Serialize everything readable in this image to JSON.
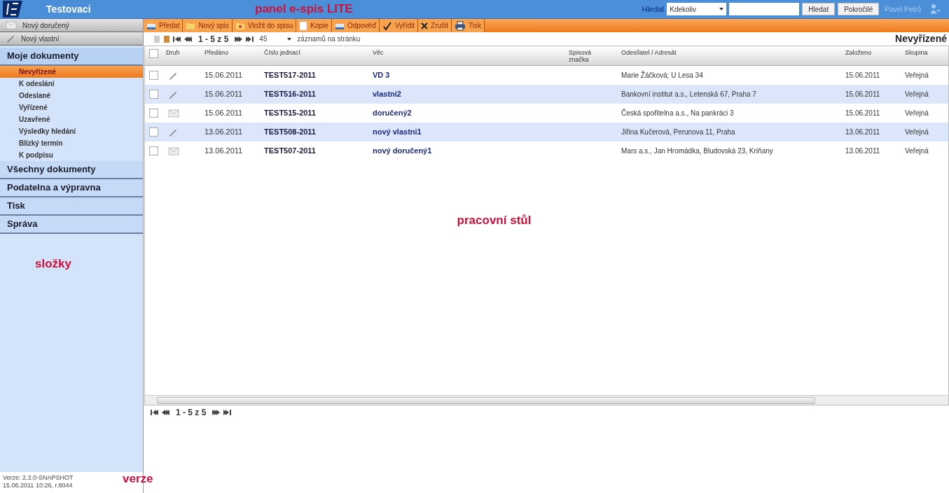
{
  "header": {
    "app_name": "Testovaci",
    "annotation": "panel e-spis LITE",
    "search_label": "Hledat",
    "scope": "Kdekoliv",
    "buttons": [
      "Hledat",
      "Pokročilé"
    ],
    "user": "Pavel Petrů"
  },
  "new_buttons": [
    {
      "label": "Nový doručený",
      "kind": "received"
    },
    {
      "label": "Nový vlastní",
      "kind": "own"
    }
  ],
  "toolbar": [
    {
      "label": "Předat",
      "kind": "tray"
    },
    {
      "label": "Nový spis",
      "kind": "folder"
    },
    {
      "label": "Vložit do spisu",
      "kind": "insert"
    },
    {
      "label": "Kopie",
      "kind": "page"
    },
    {
      "label": "Odpověď",
      "kind": "tray"
    },
    {
      "label": "Vyřídit",
      "kind": "check"
    },
    {
      "label": "Zrušit",
      "kind": "cross"
    },
    {
      "label": "Tisk",
      "kind": "print"
    }
  ],
  "pager": {
    "range": "1 - 5 z 5",
    "per_page": "45",
    "per_page_label": "záznamů na stránku"
  },
  "view_title": "Nevyřízené",
  "sidebar": [
    {
      "label": "Moje dokumenty",
      "expanded": true,
      "children": [
        {
          "label": "Nevyřízené",
          "selected": true
        },
        {
          "label": "K odeslání",
          "selected": false
        },
        {
          "label": "Odeslané",
          "selected": false
        },
        {
          "label": "Vyřízené",
          "selected": false
        },
        {
          "label": "Uzavřené",
          "selected": false
        },
        {
          "label": "Výsledky hledání",
          "selected": false
        },
        {
          "label": "Blízký termín",
          "selected": false
        },
        {
          "label": "K podpisu",
          "selected": false
        }
      ]
    },
    {
      "label": "Všechny dokumenty",
      "expanded": false
    },
    {
      "label": "Podatelna a výpravna",
      "expanded": false
    },
    {
      "label": "Tisk",
      "expanded": false
    },
    {
      "label": "Správa",
      "expanded": false
    }
  ],
  "table": {
    "all_checked": false,
    "columns": [
      "Druh",
      "Předáno",
      "Číslo jednací",
      "Věc",
      "Spisová značka",
      "Odesílatel / Adresát",
      "Založeno",
      "Skupina"
    ],
    "rows": [
      {
        "checked": false,
        "kind": "own",
        "handed": "15.06.2011",
        "number": "TEST517-2011",
        "subject": "VD 3",
        "party": "Marie Žáčková; U Lesa 34",
        "created": "15.06.2011",
        "group": "Veřejná"
      },
      {
        "checked": false,
        "kind": "own",
        "handed": "15.06.2011",
        "number": "TEST516-2011",
        "subject": "vlastni2",
        "party": "Bankovní institut a.s., Letenská 67, Praha 7",
        "created": "15.06.2011",
        "group": "Veřejná"
      },
      {
        "checked": false,
        "kind": "received",
        "handed": "15.06.2011",
        "number": "TEST515-2011",
        "subject": "doručený2",
        "party": "Česká spořitelna a.s., Na pankráci 3",
        "created": "15.06.2011",
        "group": "Veřejná"
      },
      {
        "checked": false,
        "kind": "own",
        "handed": "13.06.2011",
        "number": "TEST508-2011",
        "subject": "nový vlastni1",
        "party": "Jiřina Kučerová, Perunova 11, Praha",
        "created": "13.06.2011",
        "group": "Veřejná"
      },
      {
        "checked": false,
        "kind": "received",
        "handed": "13.06.2011",
        "number": "TEST507-2011",
        "subject": "nový doručený1",
        "party": "Mars a.s., Jan Hromádka, Bludovská 23, Kriňany",
        "created": "13.06.2011",
        "group": "Veřejná"
      }
    ]
  },
  "bottom_pager": {
    "range": "1 - 5 z 5"
  },
  "annotations": {
    "workspace": "pracovní stůl",
    "folders": "složky",
    "version": "verze"
  },
  "version": {
    "line_1": "Verze: 2.3.0-SNAPSHOT",
    "line_2": "15.06.2011 10:26, r.8044"
  }
}
